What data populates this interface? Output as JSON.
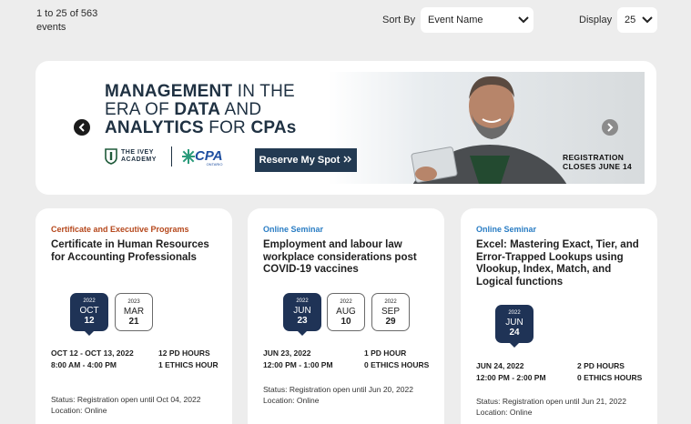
{
  "results": {
    "count_line1": "1 to 25 of 563",
    "count_line2": "events"
  },
  "sort": {
    "label": "Sort By",
    "value": "Event Name"
  },
  "display": {
    "label": "Display",
    "value": "25"
  },
  "banner": {
    "headline_bold1": "MANAGEMENT",
    "headline_light1": " IN THE",
    "headline_light2": "ERA OF ",
    "headline_bold2": "DATA",
    "headline_light3": " AND",
    "headline_bold3": "ANALYTICS",
    "headline_light4": " FOR ",
    "headline_bold4": "CPAs",
    "ivey_line1": "THE IVEY",
    "ivey_line2": "ACADEMY",
    "cpa_logo": "CPA",
    "cpa_sub": "ONTARIO",
    "reserve_label": "Reserve My Spot",
    "reg_line1": "REGISTRATION",
    "reg_line2": "CLOSES JUNE 14"
  },
  "colors": {
    "navy": "#1f3356",
    "category_orange": "#b5471b",
    "category_blue": "#2a7dc4"
  },
  "cards": [
    {
      "category": "Certificate and Executive Programs",
      "title": "Certificate in Human Resources for Accounting Professionals",
      "dates": [
        {
          "year": "2022",
          "month": "OCT",
          "day": "12"
        },
        {
          "year": "2023",
          "month": "MAR",
          "day": "21"
        }
      ],
      "date_range": "OCT 12 - OCT 13, 2022",
      "time": "8:00 AM - 4:00 PM",
      "pd_hours": "12 PD HOURS",
      "ethics_hours": "1 ETHICS HOUR",
      "status": "Status: Registration open until Oct 04, 2022",
      "location": "Location: Online"
    },
    {
      "category": "Online Seminar",
      "title": "Employment and labour law workplace considerations post COVID-19 vaccines",
      "dates": [
        {
          "year": "2022",
          "month": "JUN",
          "day": "23"
        },
        {
          "year": "2022",
          "month": "AUG",
          "day": "10"
        },
        {
          "year": "2022",
          "month": "SEP",
          "day": "29"
        }
      ],
      "date_range": "JUN 23, 2022",
      "time": "12:00 PM - 1:00 PM",
      "pd_hours": "1 PD HOUR",
      "ethics_hours": "0 ETHICS HOURS",
      "status": "Status: Registration open until Jun 20, 2022",
      "location": "Location: Online"
    },
    {
      "category": "Online Seminar",
      "title": "Excel: Mastering Exact, Tier, and Error-Trapped Lookups using Vlookup, Index, Match, and Logical functions",
      "dates": [
        {
          "year": "2022",
          "month": "JUN",
          "day": "24"
        }
      ],
      "date_range": "JUN 24, 2022",
      "time": "12:00 PM - 2:00 PM",
      "pd_hours": "2 PD HOURS",
      "ethics_hours": "0 ETHICS HOURS",
      "status": "Status: Registration open until Jun 21, 2022",
      "location": "Location: Online"
    }
  ]
}
